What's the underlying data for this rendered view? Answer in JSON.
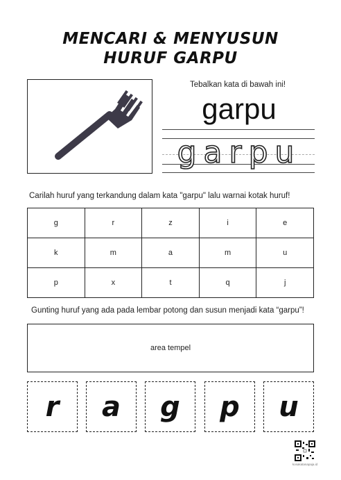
{
  "title": {
    "line1": "MENCARI & MENYUSUN",
    "line2": "HURUF GARPU"
  },
  "picture": {
    "icon": "fork-icon",
    "color": "#3d3a48"
  },
  "trace_section": {
    "instruction": "Tebalkan kata di bawah ini!",
    "word": "garpu",
    "trace_word": "garpu"
  },
  "grid_section": {
    "instruction": "Carilah huruf yang terkandung dalam kata \"garpu\" lalu warnai kotak huruf!",
    "rows": [
      [
        "g",
        "r",
        "z",
        "i",
        "e"
      ],
      [
        "k",
        "m",
        "a",
        "m",
        "u"
      ],
      [
        "p",
        "x",
        "t",
        "q",
        "j"
      ]
    ]
  },
  "cut_section": {
    "instruction": "Gunting huruf yang ada pada lembar potong dan susun menjadi kata “garpu”!",
    "paste_area": "area tempel",
    "cards": [
      "r",
      "a",
      "g",
      "p",
      "u"
    ]
  },
  "footer": {
    "qr_icon": "qr-code-icon",
    "website": "kosakatanapaja.id"
  }
}
